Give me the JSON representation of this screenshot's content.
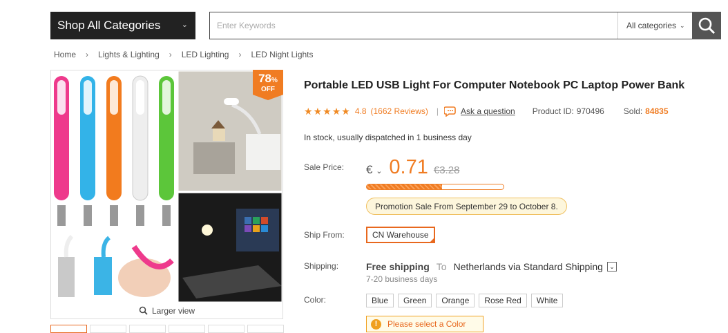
{
  "header": {
    "category_button": "Shop All Categories",
    "search_placeholder": "Enter Keywords",
    "category_select": "All categories"
  },
  "breadcrumb": [
    "Home",
    "Lights & Lighting",
    "LED Lighting",
    "LED Night Lights"
  ],
  "gallery": {
    "discount_pct": "78",
    "discount_pct_sign": "%",
    "discount_off": "OFF",
    "larger_view": "Larger view"
  },
  "product": {
    "title": "Portable LED USB Light For Computer Notebook PC Laptop Power Bank",
    "rating": "4.8",
    "reviews": "(1662 Reviews)",
    "ask": "Ask a question",
    "product_id_label": "Product ID:",
    "product_id": "970496",
    "sold_label": "Sold:",
    "sold": "84835",
    "stock": "In stock, usually dispatched in 1 business day",
    "sale_price_label": "Sale Price:",
    "currency": "€",
    "price": "0.71",
    "old_price": "€3.28",
    "sold_progress_pct": 55,
    "promo": "Promotion Sale From September 29 to October 8.",
    "ship_from_label": "Ship From:",
    "ship_from": "CN Warehouse",
    "shipping_label": "Shipping:",
    "shipping_free": "Free shipping",
    "shipping_to": "To",
    "shipping_dest": "Netherlands via Standard Shipping",
    "shipping_days": "7-20 business days",
    "color_label": "Color:",
    "colors": [
      "Blue",
      "Green",
      "Orange",
      "Rose Red",
      "White"
    ],
    "color_warning": "Please select a Color"
  },
  "accent_color": "#f07c22"
}
